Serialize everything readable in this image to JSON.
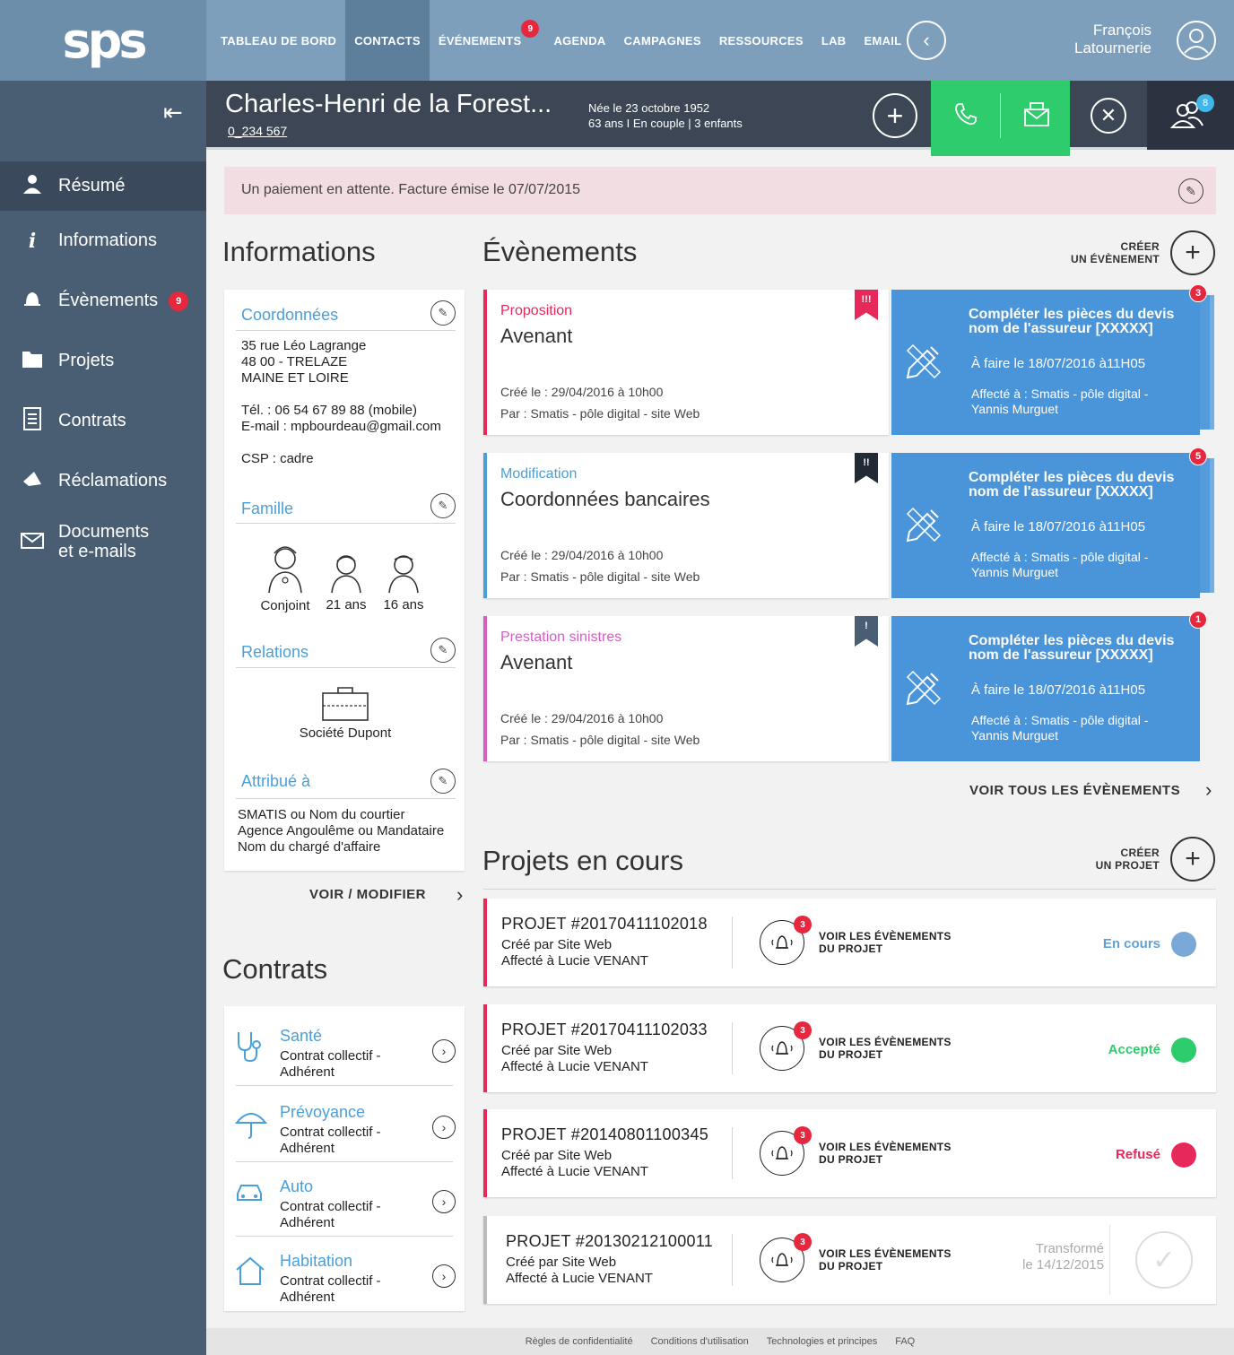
{
  "header": {
    "logo": "sps",
    "nav": [
      {
        "label": "TABLEAU DE BORD"
      },
      {
        "label": "CONTACTS"
      },
      {
        "label": "ÉVÉNEMENTS",
        "badge": "9"
      },
      {
        "label": "AGENDA"
      },
      {
        "label": "CAMPAGNES"
      },
      {
        "label": "RESSOURCES"
      },
      {
        "label": "LAB"
      },
      {
        "label": "EMAIL"
      }
    ],
    "user": {
      "first": "François",
      "last": "Latournerie"
    }
  },
  "sidebar": {
    "items": [
      {
        "label": "Résumé",
        "icon": "user-icon"
      },
      {
        "label": "Informations",
        "icon": "info-icon"
      },
      {
        "label": "Évènements",
        "icon": "bell-icon",
        "badge": "9"
      },
      {
        "label": "Projets",
        "icon": "folder-icon"
      },
      {
        "label": "Contrats",
        "icon": "document-icon"
      },
      {
        "label": "Réclamations",
        "icon": "megaphone-icon"
      },
      {
        "label_line1": "Documents",
        "label_line2": "et e-mails",
        "icon": "mail-icon"
      }
    ]
  },
  "contact": {
    "name": "Charles-Henri de la Forest...",
    "id": "0_234 567",
    "birth": "Née le 23 octobre 1952",
    "details": "63 ans  I  En couple  |  3 enfants",
    "people_badge": "8"
  },
  "alert": {
    "text": "Un paiement en attente. Facture émise le 07/07/2015"
  },
  "informations": {
    "title": "Informations",
    "coordonnees": {
      "title": "Coordonnées",
      "address1": "35 rue Léo Lagrange",
      "address2": "48 00 - TRELAZE",
      "address3": "MAINE ET LOIRE",
      "tel": "Tél. : 06 54 67 89 88 (mobile)",
      "email": "E-mail : mpbourdeau@gmail.com",
      "csp": "CSP : cadre"
    },
    "famille": {
      "title": "Famille",
      "members": [
        {
          "label": "Conjoint"
        },
        {
          "label": "21 ans"
        },
        {
          "label": "16 ans"
        }
      ]
    },
    "relations": {
      "title": "Relations",
      "company": "Société Dupont"
    },
    "attribue": {
      "title": "Attribué à",
      "line1": "SMATIS ou Nom du courtier",
      "line2": "Agence Angoulême ou Mandataire",
      "line3": "Nom du chargé d'affaire"
    },
    "voir_modifier": "VOIR / MODIFIER"
  },
  "contrats": {
    "title": "Contrats",
    "items": [
      {
        "title": "Santé",
        "sub1": "Contrat collectif -",
        "sub2": "Adhérent",
        "icon": "stethoscope-icon"
      },
      {
        "title": "Prévoyance",
        "sub1": "Contrat collectif -",
        "sub2": "Adhérent",
        "icon": "umbrella-icon"
      },
      {
        "title": "Auto",
        "sub1": "Contrat collectif -",
        "sub2": "Adhérent",
        "icon": "car-icon"
      },
      {
        "title": "Habitation",
        "sub1": "Contrat collectif -",
        "sub2": "Adhérent",
        "icon": "house-icon"
      }
    ]
  },
  "evenements": {
    "title": "Évènements",
    "create_line1": "CRÉER",
    "create_line2": "UN ÉVÈNEMENT",
    "items": [
      {
        "category": "Proposition",
        "name": "Avenant",
        "created": "Créé le : 29/04/2016 à 10h00",
        "by": "Par : Smatis - pôle digital - site Web",
        "flag": "!!!",
        "color": "#e6285a",
        "flag_color": "#e6285a"
      },
      {
        "category": "Modification",
        "name": "Coordonnées bancaires",
        "created": "Créé le : 29/04/2016 à 10h00",
        "by": "Par : Smatis - pôle digital - site Web",
        "flag": "!!",
        "color": "#4a9fd8",
        "flag_color": "#222a36"
      },
      {
        "category": "Prestation sinistres",
        "name": "Avenant",
        "created": "Créé le : 29/04/2016 à 10h00",
        "by": "Par : Smatis - pôle digital - site Web",
        "flag": "!",
        "color": "#d45ec4",
        "flag_color": "#4a5e73"
      }
    ],
    "tasks": [
      {
        "title1": "Compléter les pièces du devis",
        "title2": "nom de l'assureur [XXXXX]",
        "date": "À faire le 18/07/2016 à11H05",
        "assign1": "Affecté à : Smatis - pôle digital -",
        "assign2": "Yannis Murguet",
        "badge": "3"
      },
      {
        "title1": "Compléter les pièces du devis",
        "title2": "nom de l'assureur [XXXXX]",
        "date": "À faire le 18/07/2016 à11H05",
        "assign1": "Affecté à : Smatis - pôle digital -",
        "assign2": "Yannis Murguet",
        "badge": "5"
      },
      {
        "title1": "Compléter les pièces du devis",
        "title2": "nom de l'assureur [XXXXX]",
        "date": "À faire le 18/07/2016 à11H05",
        "assign1": "Affecté à : Smatis - pôle digital -",
        "assign2": "Yannis Murguet",
        "badge": "1"
      }
    ],
    "voir_tous": "VOIR TOUS LES ÉVÈNEMENTS"
  },
  "projets": {
    "title": "Projets en cours",
    "create_line1": "CRÉER",
    "create_line2": "UN PROJET",
    "items": [
      {
        "id": "PROJET #20170411102018",
        "created": "Créé par Site Web",
        "assigned": "Affecté à Lucie VENANT",
        "badge": "3",
        "voir1": "VOIR LES ÉVÈNEMENTS",
        "voir2": "DU PROJET",
        "status": "En cours",
        "status_color": "#5fa2d8",
        "dot": "#7aa8d6",
        "bar": "#e6285a"
      },
      {
        "id": "PROJET #20170411102033",
        "created": "Créé par Site Web",
        "assigned": "Affecté à Lucie VENANT",
        "badge": "3",
        "voir1": "VOIR LES ÉVÈNEMENTS",
        "voir2": "DU PROJET",
        "status": "Accepté",
        "status_color": "#2ecc6c",
        "dot": "#2ecc6c",
        "bar": "#e6285a"
      },
      {
        "id": "PROJET #20140801100345",
        "created": "Créé par Site Web",
        "assigned": "Affecté à Lucie VENANT",
        "badge": "3",
        "voir1": "VOIR LES ÉVÈNEMENTS",
        "voir2": "DU PROJET",
        "status": "Refusé",
        "status_color": "#e6285a",
        "dot": "#e6285a",
        "bar": "#e6285a"
      },
      {
        "id": "PROJET #20130212100011",
        "created": "Créé par Site Web",
        "assigned": "Affecté à Lucie VENANT",
        "badge": "3",
        "voir1": "VOIR LES ÉVÈNEMENTS",
        "voir2": "DU PROJET",
        "status_line1": "Transformé",
        "status_line2": "le 14/12/2015",
        "bar": "#bbbbbb"
      }
    ]
  },
  "footer": {
    "links": [
      "Règles de confidentialité",
      "Conditions d'utilisation",
      "Technologies et principes",
      "FAQ"
    ]
  }
}
